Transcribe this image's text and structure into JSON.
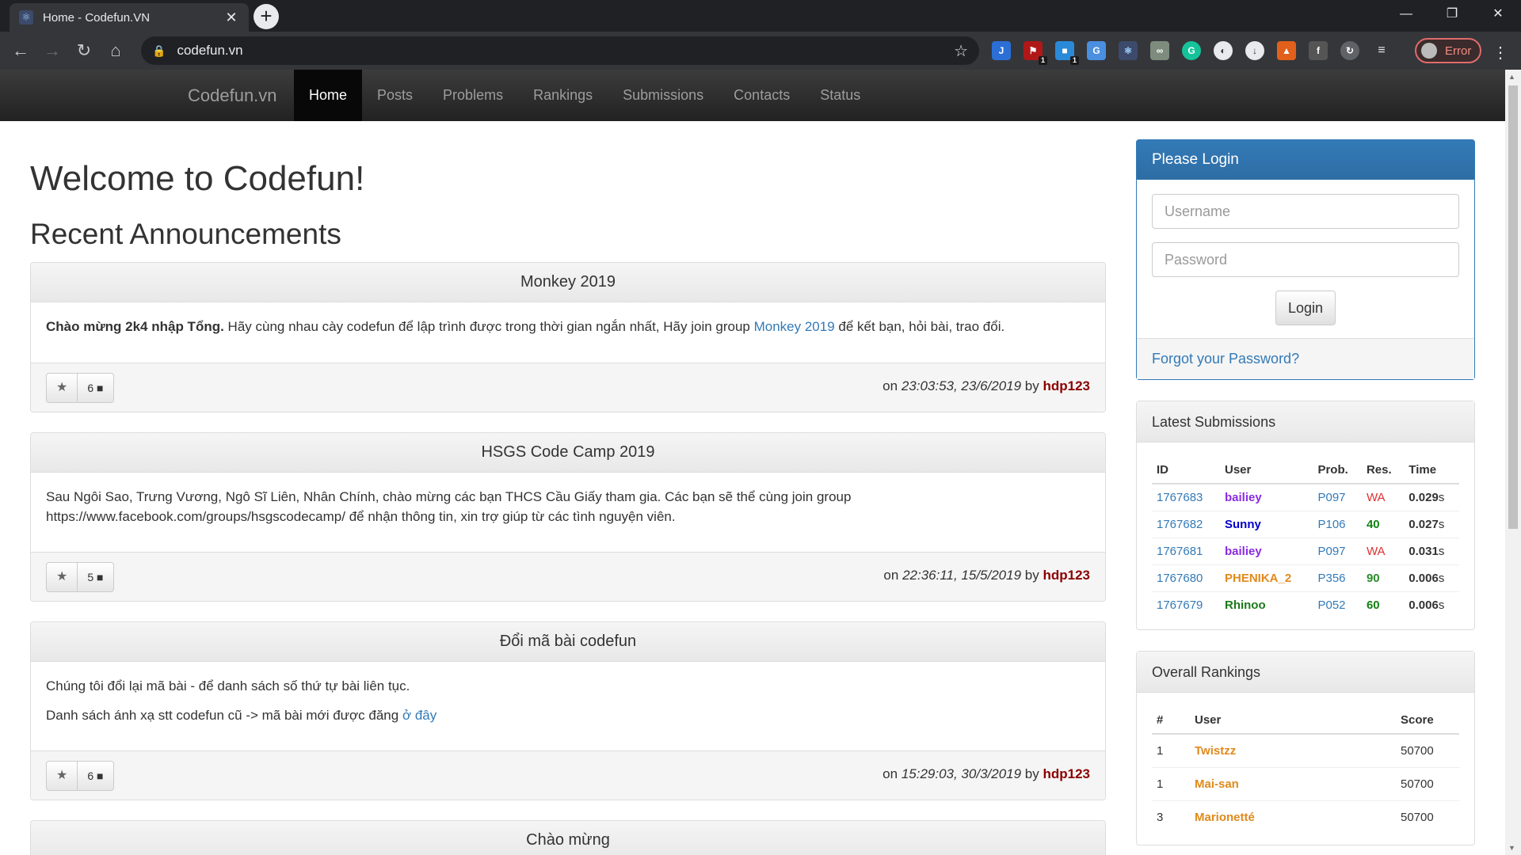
{
  "browser": {
    "tab_title": "Home - Codefun.VN",
    "url": "codefun.vn",
    "error_label": "Error",
    "window_controls": [
      "—",
      "❐",
      "✕"
    ]
  },
  "navbar": {
    "brand": "Codefun.vn",
    "items": [
      "Home",
      "Posts",
      "Problems",
      "Rankings",
      "Submissions",
      "Contacts",
      "Status"
    ],
    "active": "Home"
  },
  "main": {
    "welcome": "Welcome to Codefun!",
    "recent_title": "Recent Announcements",
    "announcements": [
      {
        "title": "Monkey 2019",
        "body_bold": "Chào mừng 2k4 nhập Tổng.",
        "body_text": " Hãy cùng nhau cày codefun để lập trình được trong thời gian ngắn nhất, Hãy join group ",
        "body_link": "Monkey 2019",
        "body_tail": " để kết bạn, hỏi bài, trao đổi.",
        "comments": "6",
        "on": "on ",
        "time": "23:03:53, 23/6/2019",
        "by": " by ",
        "author": "hdp123"
      },
      {
        "title": "HSGS Code Camp 2019",
        "body_text": "Sau Ngôi Sao, Trưng Vương, Ngô Sĩ Liên, Nhân Chính, chào mừng các bạn THCS Cầu Giấy tham gia. Các bạn sẽ thể cùng join group https://www.facebook.com/groups/hsgscodecamp/ để nhận thông tin, xin trợ giúp từ các tình nguyện viên.",
        "comments": "5",
        "on": "on ",
        "time": "22:36:11, 15/5/2019",
        "by": " by ",
        "author": "hdp123"
      },
      {
        "title": "Đổi mã bài codefun",
        "body_line1": "Chúng tôi đổi lại mã bài - để danh sách số thứ tự bài liên tục.",
        "body_line2": "Danh sách ánh xạ stt codefun cũ -> mã bài mới được đăng ",
        "body_link": "ở đây",
        "comments": "6",
        "on": "on ",
        "time": "15:29:03, 30/3/2019",
        "by": " by ",
        "author": "hdp123"
      },
      {
        "title": "Chào mừng"
      }
    ],
    "star_icon": "★"
  },
  "login": {
    "heading": "Please Login",
    "username_placeholder": "Username",
    "password_placeholder": "Password",
    "button": "Login",
    "forgot": "Forgot your Password?"
  },
  "submissions": {
    "heading": "Latest Submissions",
    "columns": [
      "ID",
      "User",
      "Prob.",
      "Res.",
      "Time"
    ],
    "rows": [
      {
        "id": "1767683",
        "user": "bailiey",
        "prob": "P097",
        "res": "WA",
        "time": "0.029",
        "unit": "s"
      },
      {
        "id": "1767682",
        "user": "Sunny",
        "prob": "P106",
        "res": "40",
        "time": "0.027",
        "unit": "s"
      },
      {
        "id": "1767681",
        "user": "bailiey",
        "prob": "P097",
        "res": "WA",
        "time": "0.031",
        "unit": "s"
      },
      {
        "id": "1767680",
        "user": "PHENIKA_2",
        "prob": "P356",
        "res": "90",
        "time": "0.006",
        "unit": "s"
      },
      {
        "id": "1767679",
        "user": "Rhinoo",
        "prob": "P052",
        "res": "60",
        "time": "0.006",
        "unit": "s"
      }
    ]
  },
  "rankings": {
    "heading": "Overall Rankings",
    "columns": [
      "#",
      "User",
      "Score"
    ],
    "rows": [
      {
        "rank": "1",
        "user": "Twistzz",
        "score": "50700"
      },
      {
        "rank": "1",
        "user": "Mai-san",
        "score": "50700"
      },
      {
        "rank": "3",
        "user": "Marionetté",
        "score": "50700"
      }
    ]
  },
  "colors": {
    "brand_blue": "#337ab7",
    "navbar_dark": "#222222",
    "author_red": "#8b0000"
  }
}
